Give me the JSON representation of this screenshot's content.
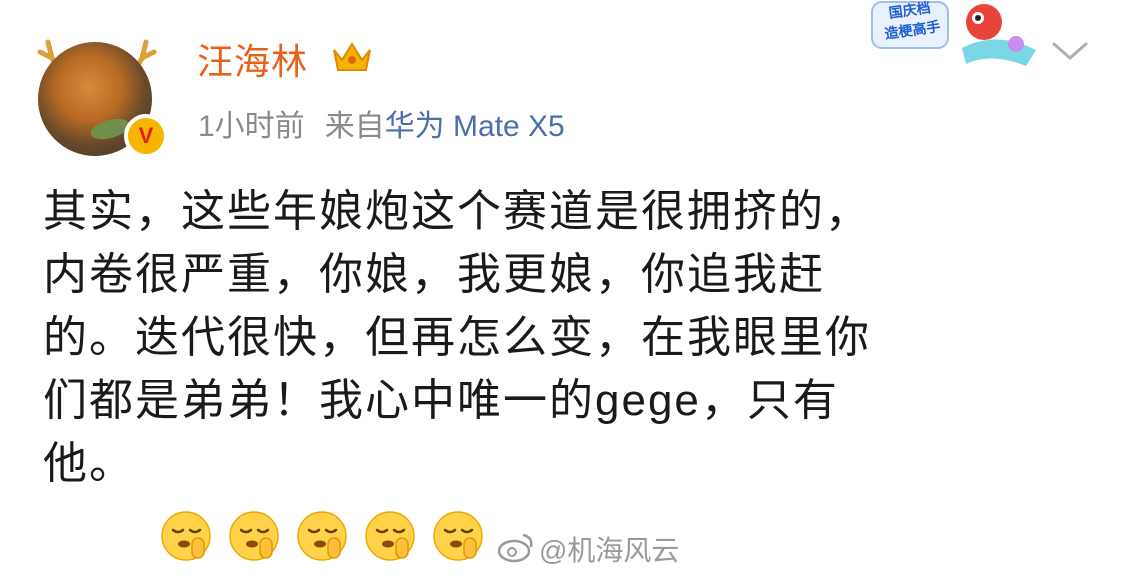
{
  "post": {
    "username": "汪海林",
    "time": "1小时前",
    "source_label": "来自",
    "device": "华为 Mate X5",
    "verified_badge": "V",
    "body_lines": [
      "其实，这些年娘炮这个赛道是很拥挤的，",
      "内卷很严重，你娘，我更娘，你追我赶",
      "的。迭代很快，但再怎么变，在我眼里你",
      "们都是弟弟！我心中唯一的gege，只有",
      "他。"
    ],
    "emoji_name": "shush-face-icon",
    "emoji_count": 5
  },
  "sticker": {
    "line1": "国庆档",
    "line2": "造梗高手"
  },
  "watermark": {
    "text": "@机海风云"
  },
  "colors": {
    "username": "#e8611b",
    "meta": "#8a8a8a",
    "device": "#4a6faa",
    "body": "#1a1a1a"
  }
}
